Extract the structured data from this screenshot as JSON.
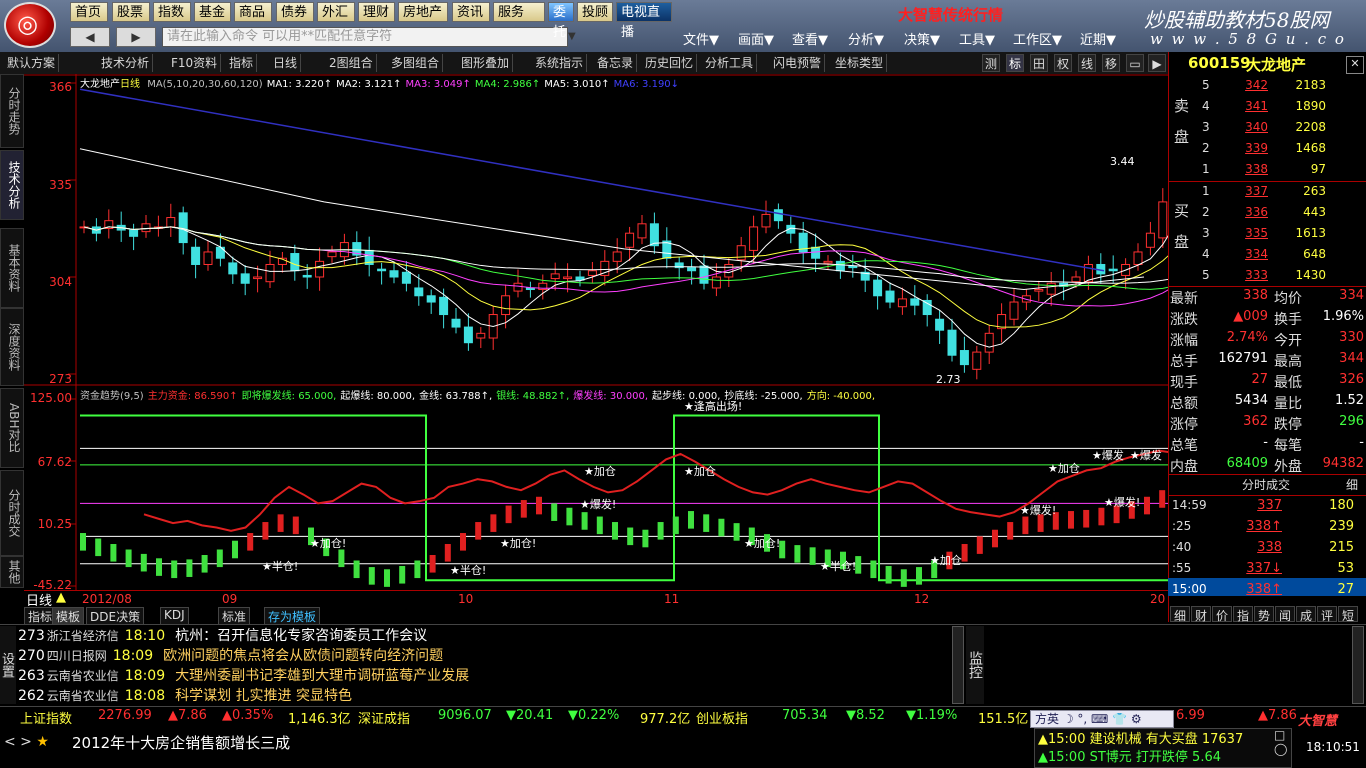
{
  "nav": {
    "items": [
      "首页",
      "股票",
      "指数",
      "基金",
      "商品",
      "债券",
      "外汇",
      "理财",
      "房地产",
      "资讯",
      "服务",
      "委托",
      "投顾",
      "电视直播"
    ],
    "banner": "大智慧传统行情",
    "brand": "炒股辅助教材58股网",
    "brand_url": "w w w . 5 8 G u . c o m",
    "command_placeholder": "请在此输入命令    可以用**匹配任意字符",
    "back": "◀",
    "forward": "▶",
    "menus": [
      "文件▼",
      "画面▼",
      "查看▼",
      "分析▼",
      "决策▼",
      "工具▼",
      "工作区▼",
      "近期▼"
    ]
  },
  "toolbar": {
    "items": [
      "默认方案",
      "技术分析",
      "F10资料",
      "指标",
      "日线",
      "2图组合",
      "多图组合",
      "图形叠加",
      "系统指示",
      "备忘录",
      "历史回忆",
      "分析工具",
      "闪电预警",
      "坐标类型"
    ],
    "right_buttons": [
      "测",
      "标",
      "田",
      "权",
      "线",
      "移"
    ]
  },
  "left_tabs": [
    "分时走势",
    "技术分析",
    "基本资料",
    "深度资料",
    "ABH对比",
    "分时成交",
    "其他"
  ],
  "chart": {
    "stock_name": "大龙地产",
    "period": "日线",
    "ma_legend": [
      {
        "text": "MA(5,10,20,30,60,120)",
        "color": "#c0c0c0"
      },
      {
        "text": "MA1: 3.220↑",
        "color": "#ffffff"
      },
      {
        "text": "MA2: 3.121↑",
        "color": "#ffffff"
      },
      {
        "text": "MA3: 3.049↑",
        "color": "#ff40ff"
      },
      {
        "text": "MA4: 2.986↑",
        "color": "#40ff40"
      },
      {
        "text": "MA5: 3.010↑",
        "color": "#ffffff"
      },
      {
        "text": "MA6: 3.190↓",
        "color": "#4040ff"
      }
    ],
    "price_ticks": [
      "366",
      "335",
      "304",
      "273"
    ],
    "high_label": "3.44",
    "low_label": "2.73",
    "indicator_legend": [
      {
        "text": "资金趋势(9,5)",
        "color": "#c0c0c0"
      },
      {
        "text": "主力资金: 86.590↑",
        "color": "#ff3030"
      },
      {
        "text": "即将爆发线: 65.000,",
        "color": "#40ff40"
      },
      {
        "text": "起爆线: 80.000,",
        "color": "#ffffff"
      },
      {
        "text": "金线: 63.788↑,",
        "color": "#ffffff"
      },
      {
        "text": "银线: 48.882↑,",
        "color": "#40ff40"
      },
      {
        "text": "爆发线: 30.000,",
        "color": "#ff40ff"
      },
      {
        "text": "起步线: 0.000,",
        "color": "#ffffff"
      },
      {
        "text": "抄底线: -25.000,",
        "color": "#ffffff"
      },
      {
        "text": "方向: -40.000,",
        "color": "#ffff40"
      }
    ],
    "ind_ticks": [
      "125.00",
      "67.62",
      "10.25",
      "-45.22"
    ],
    "ind_labels": [
      "★逢高出场!",
      "★加仓",
      "★加仓",
      "★爆发!",
      "★加仓!",
      "★加仓!",
      "★加仓!",
      "★半仓!",
      "★半仓!",
      "★半仓!",
      "★加仓",
      "★爆发!",
      "★爆发!",
      "★加仓",
      "★爆发",
      "★爆发"
    ],
    "date_labels": [
      "2012/08",
      "09",
      "10",
      "11",
      "12",
      "20"
    ],
    "bottom_tabs": [
      "指标",
      "模板",
      "DDE决策",
      "KDJ",
      "标准",
      "存为模板"
    ]
  },
  "quote": {
    "code": "600159",
    "name": "大龙地产",
    "sell_label": "卖盘",
    "buy_label": "买盘",
    "sell": [
      {
        "lvl": "5",
        "px": "342",
        "vol": "2183"
      },
      {
        "lvl": "4",
        "px": "341",
        "vol": "1890"
      },
      {
        "lvl": "3",
        "px": "340",
        "vol": "2208"
      },
      {
        "lvl": "2",
        "px": "339",
        "vol": "1468"
      },
      {
        "lvl": "1",
        "px": "338",
        "vol": "97"
      }
    ],
    "buy": [
      {
        "lvl": "1",
        "px": "337",
        "vol": "263"
      },
      {
        "lvl": "2",
        "px": "336",
        "vol": "443"
      },
      {
        "lvl": "3",
        "px": "335",
        "vol": "1613"
      },
      {
        "lvl": "4",
        "px": "334",
        "vol": "648"
      },
      {
        "lvl": "5",
        "px": "333",
        "vol": "1430"
      }
    ],
    "stats": [
      {
        "l1": "最新",
        "v1": "338",
        "c1": "#ff3030",
        "l2": "均价",
        "v2": "334",
        "c2": "#ff3030"
      },
      {
        "l1": "涨跌",
        "v1": "▲009",
        "c1": "#ff3030",
        "l2": "换手",
        "v2": "1.96%",
        "c2": "#ffffff"
      },
      {
        "l1": "涨幅",
        "v1": "2.74%",
        "c1": "#ff3030",
        "l2": "今开",
        "v2": "330",
        "c2": "#ff3030"
      },
      {
        "l1": "总手",
        "v1": "162791",
        "c1": "#ffffff",
        "l2": "最高",
        "v2": "344",
        "c2": "#ff3030"
      },
      {
        "l1": "现手",
        "v1": "27",
        "c1": "#ff3030",
        "l2": "最低",
        "v2": "326",
        "c2": "#ff3030"
      },
      {
        "l1": "总额",
        "v1": "5434",
        "c1": "#ffffff",
        "l2": "量比",
        "v2": "1.52",
        "c2": "#ffffff"
      },
      {
        "l1": "涨停",
        "v1": "362",
        "c1": "#ff3030",
        "l2": "跌停",
        "v2": "296",
        "c2": "#40ff40"
      },
      {
        "l1": "总笔",
        "v1": "-",
        "c1": "#ffffff",
        "l2": "每笔",
        "v2": "-",
        "c2": "#ffffff"
      },
      {
        "l1": "内盘",
        "v1": "68409",
        "c1": "#40ff40",
        "l2": "外盘",
        "v2": "94382",
        "c2": "#ff3030"
      }
    ],
    "ticks_title": "分时成交",
    "ticks_btn": "细",
    "ticks": [
      {
        "t": "14:59",
        "p": "337",
        "c": "#ff3030",
        "v": "180"
      },
      {
        "t": ":25",
        "p": "338↑",
        "c": "#ff3030",
        "v": "239"
      },
      {
        "t": ":40",
        "p": "338",
        "c": "#ff3030",
        "v": "215"
      },
      {
        "t": ":55",
        "p": "337↓",
        "c": "#ff3030",
        "v": "53"
      },
      {
        "t": "15:00",
        "p": "338↑",
        "c": "#ff3030",
        "v": "27"
      }
    ],
    "bottom_tabs": [
      "细",
      "财",
      "价",
      "指",
      "势",
      "闻",
      "成",
      "评",
      "短"
    ]
  },
  "news": [
    {
      "n": "273",
      "src": "浙江省经济信",
      "tm": "18:10",
      "title": "杭州：召开信息化专家咨询委员工作会议",
      "titlecolor": "#ffffff"
    },
    {
      "n": "270",
      "src": "四川日报网",
      "tm": "18:09",
      "title": "欧洲问题的焦点将会从欧债问题转向经济问题",
      "titlecolor": "#ffd060"
    },
    {
      "n": "263",
      "src": "云南省农业信",
      "tm": "18:09",
      "title": "大理州委副书记李雄到大理市调研蓝莓产业发展",
      "titlecolor": "#ffd060"
    },
    {
      "n": "262",
      "src": "云南省农业信",
      "tm": "18:08",
      "title": "科学谋划 扎实推进 突显特色",
      "titlecolor": "#ffd060"
    }
  ],
  "news_side": {
    "setup": "设置",
    "monitor": "监控"
  },
  "status": [
    {
      "text": "上证指数",
      "c": "#ffff40"
    },
    {
      "text": "2276.99",
      "c": "#ff3030"
    },
    {
      "text": "▲7.86",
      "c": "#ff3030"
    },
    {
      "text": "▲0.35%",
      "c": "#ff3030"
    },
    {
      "text": "1,146.3亿",
      "c": "#ffff40"
    },
    {
      "text": "深证成指",
      "c": "#ffff40"
    },
    {
      "text": "9096.07",
      "c": "#40ff40"
    },
    {
      "text": "▼20.41",
      "c": "#40ff40"
    },
    {
      "text": "▼0.22%",
      "c": "#40ff40"
    },
    {
      "text": "977.2亿",
      "c": "#ffff40"
    },
    {
      "text": "创业板指",
      "c": "#ffff40"
    },
    {
      "text": "705.34",
      "c": "#40ff40"
    },
    {
      "text": "▼8.52",
      "c": "#40ff40"
    },
    {
      "text": "▼1.19%",
      "c": "#40ff40"
    },
    {
      "text": "151.5亿",
      "c": "#ffff40"
    }
  ],
  "status_right": {
    "a": "6.99",
    "b": "▲7.86"
  },
  "ticker": {
    "text": "2012年十大房企销售额增长三成"
  },
  "alerts": [
    {
      "text": "▲15:00 建设机械  有大买盘 17637",
      "c": "#ffff40"
    },
    {
      "text": "▲15:00 ST博元   打开跌停 5.64",
      "c": "#40ff40"
    }
  ],
  "ime": "方英",
  "clock": "18:10:51",
  "corner_logo": "大智慧",
  "date_bar_left": "日线"
}
